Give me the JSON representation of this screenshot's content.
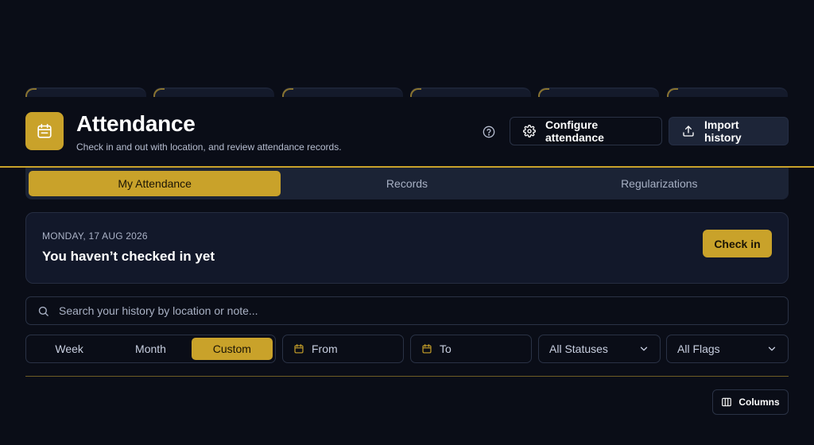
{
  "header": {
    "title": "Attendance",
    "subtitle": "Check in and out with location, and review attendance records.",
    "configure_label": "Configure attendance",
    "import_label": "Import history"
  },
  "tabs": [
    {
      "label": "My Attendance",
      "active": true
    },
    {
      "label": "Records",
      "active": false
    },
    {
      "label": "Regularizations",
      "active": false
    }
  ],
  "today": {
    "date": "MONDAY, 17 AUG 2026",
    "status": "You haven’t checked in yet",
    "checkin_label": "Check in"
  },
  "search": {
    "placeholder": "Search your history by location or note..."
  },
  "filters": {
    "range": [
      {
        "label": "Week",
        "active": false
      },
      {
        "label": "Month",
        "active": false
      },
      {
        "label": "Custom",
        "active": true
      }
    ],
    "from_label": "From",
    "to_label": "To",
    "status_value": "All Statuses",
    "flags_value": "All Flags"
  },
  "table": {
    "columns_label": "Columns"
  },
  "colors": {
    "accent": "#c9a22a",
    "background": "#0a0d17",
    "panel": "#12182a"
  }
}
